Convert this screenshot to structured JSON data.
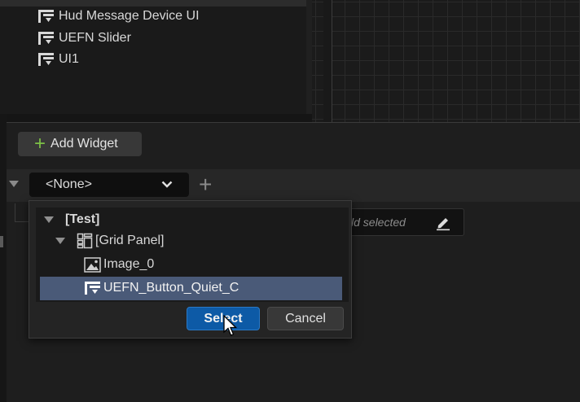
{
  "hierarchy": {
    "items": [
      {
        "label": "Hud Message Device UI",
        "icon": "widget-icon"
      },
      {
        "label": "UEFN Slider",
        "icon": "widget-icon"
      },
      {
        "label": "UI1",
        "icon": "widget-icon"
      }
    ]
  },
  "details": {
    "add_widget_label": "Add Widget",
    "binding_combo_value": "<None>",
    "field_placeholder": "ld selected"
  },
  "picker": {
    "tree": [
      {
        "label": "[Test]"
      },
      {
        "label": "[Grid Panel]"
      },
      {
        "label": "Image_0"
      },
      {
        "label": "UEFN_Button_Quiet_C"
      }
    ],
    "select_label": "Select",
    "cancel_label": "Cancel"
  },
  "colors": {
    "accent_blue": "#0d5aa6",
    "selection": "#4a5a78",
    "plus_green": "#7cc046"
  }
}
